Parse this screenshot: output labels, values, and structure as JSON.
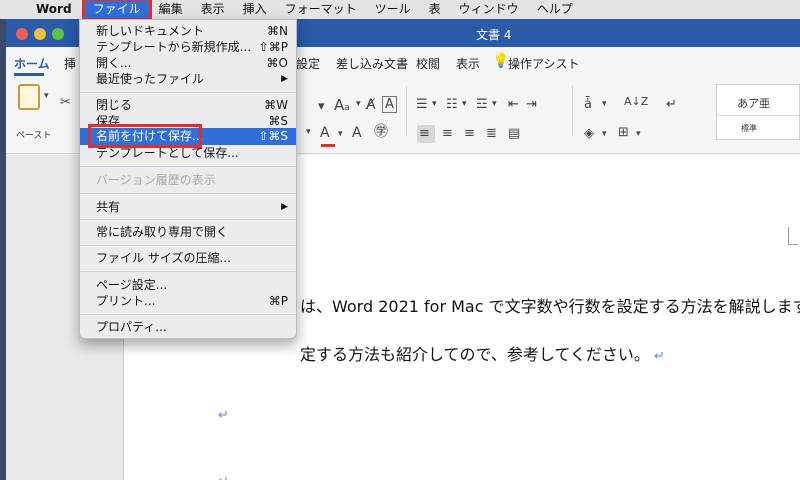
{
  "menubar": {
    "app": "Word",
    "items": [
      "ファイル",
      "編集",
      "表示",
      "挿入",
      "フォーマット",
      "ツール",
      "表",
      "ウィンドウ",
      "ヘルプ"
    ]
  },
  "window": {
    "title": "文書 4",
    "tabs": [
      "ホーム",
      "挿",
      "設定",
      "差し込み文書",
      "校閲",
      "表示",
      "操作アシスト"
    ]
  },
  "ribbon": {
    "paste_label": "ペースト",
    "style_sample": "あア亜",
    "style_name": "標準"
  },
  "file_menu": {
    "new_document": "新しいドキュメント",
    "new_document_shortcut": "⌘N",
    "new_from_template": "テンプレートから新規作成...",
    "new_from_template_shortcut": "⇧⌘P",
    "open": "開く...",
    "open_shortcut": "⌘O",
    "recent": "最近使ったファイル",
    "close": "閉じる",
    "close_shortcut": "⌘W",
    "save": "保存",
    "save_shortcut": "⌘S",
    "save_as": "名前を付けて保存...",
    "save_as_shortcut": "⇧⌘S",
    "save_as_template": "テンプレートとして保存...",
    "version_history": "バージョン履歴の表示",
    "share": "共有",
    "open_read_only": "常に読み取り専用で開く",
    "reduce_size": "ファイル サイズの圧縮...",
    "page_setup": "ページ設定...",
    "print": "プリント...",
    "print_shortcut": "⌘P",
    "properties": "プロパティ..."
  },
  "document": {
    "line1": "は、Word 2021 for Mac で文字数や行数を設定する方法を解説します",
    "line2": "定する方法も紹介してので、参考してください。",
    "para_mark": "↵"
  }
}
